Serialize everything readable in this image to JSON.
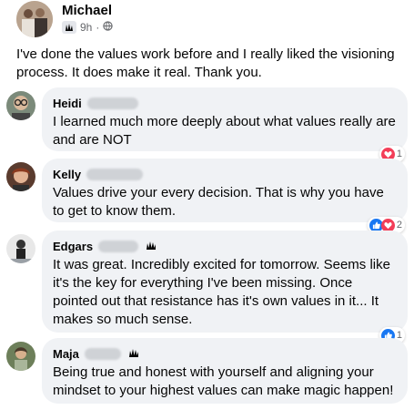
{
  "post": {
    "author": "Michael",
    "time": "9h",
    "text": "I've done the values work before and I really liked the visioning process. It does make it real. Thank you."
  },
  "comments": [
    {
      "name": "Heidi",
      "text": "I learned much more deeply about what values really are and are NOT",
      "reactions": [
        "love"
      ],
      "reaction_count": "1"
    },
    {
      "name": "Kelly",
      "text": "Values drive your every decision. That is why you have to get to know them.",
      "reactions": [
        "like",
        "love"
      ],
      "reaction_count": "2"
    },
    {
      "name": "Edgars",
      "text": "It was great. Incredibly excited for tomorrow. Seems like it's the key for everything I've been missing. Once pointed out that resistance has it's own values in it... It makes so much sense.",
      "reactions": [
        "like"
      ],
      "reaction_count": "1"
    },
    {
      "name": "Maja",
      "text": "Being true and honest with yourself and aligning your mindset to your highest values can make magic happen!"
    }
  ],
  "colors": {
    "bubble": "#f0f2f5",
    "like": "#1877f2",
    "love": "#f33e58",
    "meta": "#65676b"
  }
}
